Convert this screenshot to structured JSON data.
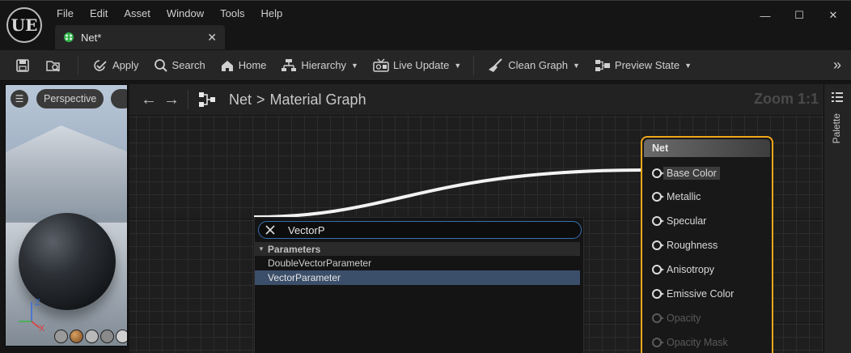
{
  "menu": [
    "File",
    "Edit",
    "Asset",
    "Window",
    "Tools",
    "Help"
  ],
  "logo": "UE",
  "tab": {
    "label": "Net*",
    "close": "✕",
    "icon": "material-icon"
  },
  "window_controls": {
    "minimize": "—",
    "maximize": "☐",
    "close": "✕"
  },
  "toolbar": {
    "apply": "Apply",
    "search": "Search",
    "home": "Home",
    "hierarchy": "Hierarchy",
    "live_update": "Live Update",
    "clean_graph": "Clean Graph",
    "preview_state": "Preview State",
    "more": "»"
  },
  "viewport": {
    "menu_icon": "☰",
    "perspective": "Perspective",
    "axis_z": "Z",
    "axis_x": "X"
  },
  "graph": {
    "breadcrumb_root": "Net",
    "breadcrumb_sep": ">",
    "breadcrumb_leaf": "Material Graph",
    "zoom": "Zoom 1:1",
    "back": "←",
    "forward": "→"
  },
  "palette": {
    "label": "Palette"
  },
  "node": {
    "title": "Net",
    "pins": [
      {
        "label": "Base Color",
        "enabled": true,
        "highlight": true
      },
      {
        "label": "Metallic",
        "enabled": true
      },
      {
        "label": "Specular",
        "enabled": true
      },
      {
        "label": "Roughness",
        "enabled": true
      },
      {
        "label": "Anisotropy",
        "enabled": true
      },
      {
        "label": "Emissive Color",
        "enabled": true
      },
      {
        "label": "Opacity",
        "enabled": false
      },
      {
        "label": "Opacity Mask",
        "enabled": false
      }
    ]
  },
  "search_popup": {
    "query": "VectorP",
    "category": "Parameters",
    "results": [
      {
        "label": "DoubleVectorParameter",
        "selected": false
      },
      {
        "label": "VectorParameter",
        "selected": true
      }
    ]
  },
  "colors": {
    "accent": "#f0a818",
    "selection": "#3b4f6a",
    "search_border": "#3a6fb4"
  }
}
